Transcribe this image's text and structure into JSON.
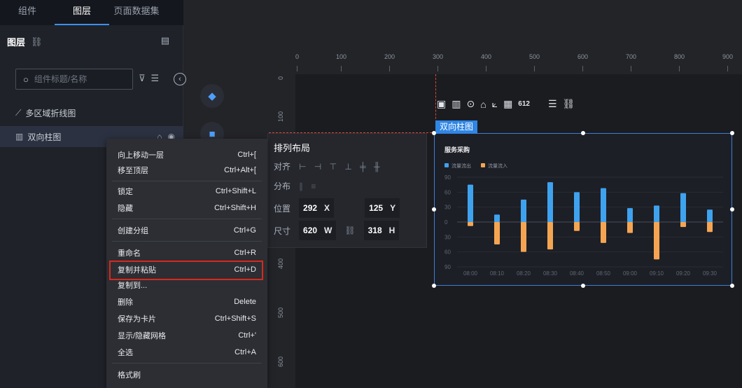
{
  "tabs": [
    "组件",
    "图层",
    "页面数据集"
  ],
  "active_tab": 1,
  "layer_panel": {
    "title": "图层",
    "search_placeholder": "组件标题/名称",
    "items": [
      {
        "label": "多区域折线图",
        "icon": "line-chart-icon"
      },
      {
        "label": "双向柱图",
        "icon": "bar-chart-icon"
      }
    ]
  },
  "ruler": {
    "top_ticks": [
      "0",
      "100",
      "200",
      "300",
      "400",
      "500",
      "600",
      "700",
      "800",
      "900"
    ],
    "left_ticks": [
      "0",
      "100",
      "400",
      "500",
      "600"
    ]
  },
  "chart_toolbar_icons": [
    "image-icon",
    "bar-icon",
    "target-icon",
    "interaction-icon",
    "axis-icon",
    "series-icon",
    "number-icon",
    "database-icon",
    "link-icon"
  ],
  "chart_toolbar_label": "612",
  "component": {
    "tag": "双向柱图"
  },
  "chart_data": {
    "type": "bar",
    "title": "服务采购",
    "categories": [
      "08:00",
      "08:10",
      "08:20",
      "08:30",
      "08:40",
      "08:50",
      "09:00",
      "09:10",
      "09:20",
      "09:30"
    ],
    "series": [
      {
        "name": "流量流出",
        "color": "#3ea2ef",
        "values": [
          75,
          15,
          45,
          80,
          60,
          68,
          28,
          33,
          58,
          25
        ]
      },
      {
        "name": "流量流入",
        "color": "#f5a552",
        "values": [
          -8,
          -45,
          -60,
          -55,
          -18,
          -42,
          -22,
          -75,
          -10,
          -20
        ]
      }
    ],
    "yticks": [
      "90",
      "60",
      "30",
      "0",
      "30",
      "60",
      "90"
    ],
    "ylim": [
      -90,
      90
    ],
    "legend": "top-left",
    "grid": true
  },
  "context_menu": {
    "items": [
      {
        "label": "向上移动一层",
        "shortcut": "Ctrl+["
      },
      {
        "label": "移至顶层",
        "shortcut": "Ctrl+Alt+["
      },
      {
        "label": "锁定",
        "shortcut": "Ctrl+Shift+L"
      },
      {
        "label": "隐藏",
        "shortcut": "Ctrl+Shift+H"
      },
      {
        "label": "创建分组",
        "shortcut": "Ctrl+G"
      },
      {
        "label": "重命名",
        "shortcut": "Ctrl+R"
      },
      {
        "label": "复制并粘贴",
        "shortcut": "Ctrl+D"
      },
      {
        "label": "复制到...",
        "shortcut": ""
      },
      {
        "label": "删除",
        "shortcut": "Delete"
      },
      {
        "label": "保存为卡片",
        "shortcut": "Ctrl+Shift+S"
      },
      {
        "label": "显示/隐藏网格",
        "shortcut": "Ctrl+'"
      },
      {
        "label": "全选",
        "shortcut": "Ctrl+A"
      },
      {
        "label": "格式刷",
        "shortcut": ""
      }
    ]
  },
  "layout_panel": {
    "title": "排列布局",
    "align_label": "对齐",
    "distribute_label": "分布",
    "position_label": "位置",
    "size_label": "尺寸",
    "x": "292",
    "x_axis": "X",
    "y": "125",
    "y_axis": "Y",
    "w": "620",
    "w_axis": "W",
    "h": "318",
    "h_axis": "H"
  },
  "colors": {
    "accent": "#2f86e6",
    "highlight": "#d8281e"
  }
}
